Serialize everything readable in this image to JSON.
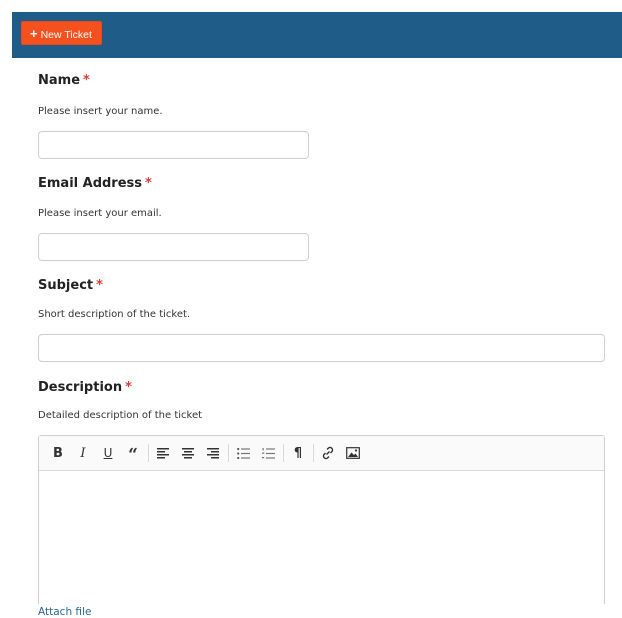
{
  "header": {
    "new_ticket_label": "New Ticket"
  },
  "form": {
    "name": {
      "label": "Name",
      "required_mark": "*",
      "help": "Please insert your name.",
      "value": ""
    },
    "email": {
      "label": "Email Address",
      "required_mark": "*",
      "help": "Please insert your email.",
      "value": ""
    },
    "subject": {
      "label": "Subject",
      "required_mark": "*",
      "help": "Short description of the ticket.",
      "value": ""
    },
    "description": {
      "label": "Description",
      "required_mark": "*",
      "help": "Detailed description of the ticket"
    }
  },
  "editor_toolbar": {
    "bold": "B",
    "italic": "I",
    "underline": "U",
    "quote": "“",
    "paragraph": "¶"
  },
  "attach_label": "Attach file",
  "colors": {
    "header_bg": "#1f5c87",
    "button_bg": "#f4511e",
    "required": "#e53935",
    "link": "#2a6496"
  }
}
